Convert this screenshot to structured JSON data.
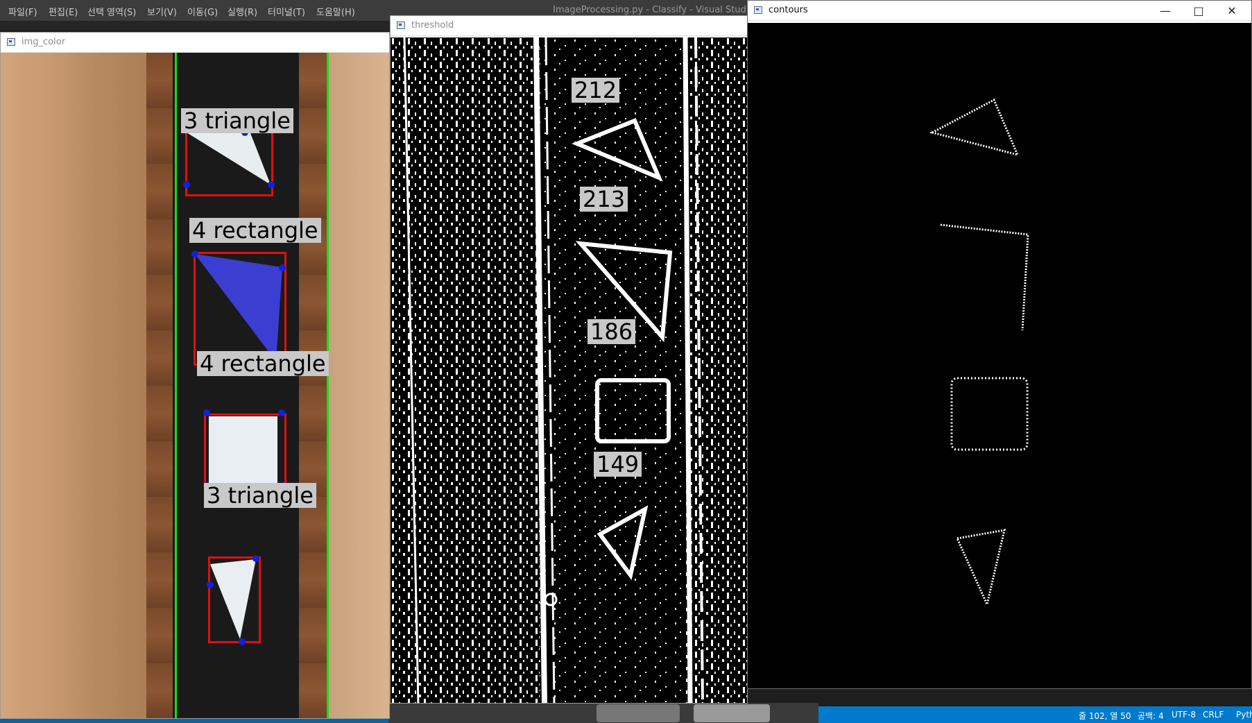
{
  "vscode": {
    "menu": [
      "파일(F)",
      "편집(E)",
      "선택 영역(S)",
      "보기(V)",
      "이동(G)",
      "실행(R)",
      "터미널(T)",
      "도움말(H)"
    ],
    "title": "ImageProcessing.py - Classify - Visual Studio Code",
    "status": {
      "position": "줄 102, 열 50",
      "spaces": "공백: 4",
      "encoding": "UTF-8",
      "eol": "CRLF",
      "language": "Pyth"
    },
    "status_color": "#007acc"
  },
  "windows": {
    "img_color": {
      "title": "img_color",
      "labels": [
        "3 triangle",
        "4 rectangle",
        "4 rectangle",
        "3 triangle"
      ],
      "colors": {
        "bbox": "#e01010",
        "vertex": "#1020e0",
        "guide": "#16dd16",
        "shape_blue": "#3b3ed0"
      }
    },
    "threshold": {
      "title": "threshold",
      "labels": [
        "212",
        "213",
        "186",
        "149"
      ]
    },
    "contours": {
      "title": "contours",
      "controls": {
        "minimize": "minimize-icon",
        "maximize": "maximize-icon",
        "close": "close-icon"
      }
    }
  }
}
